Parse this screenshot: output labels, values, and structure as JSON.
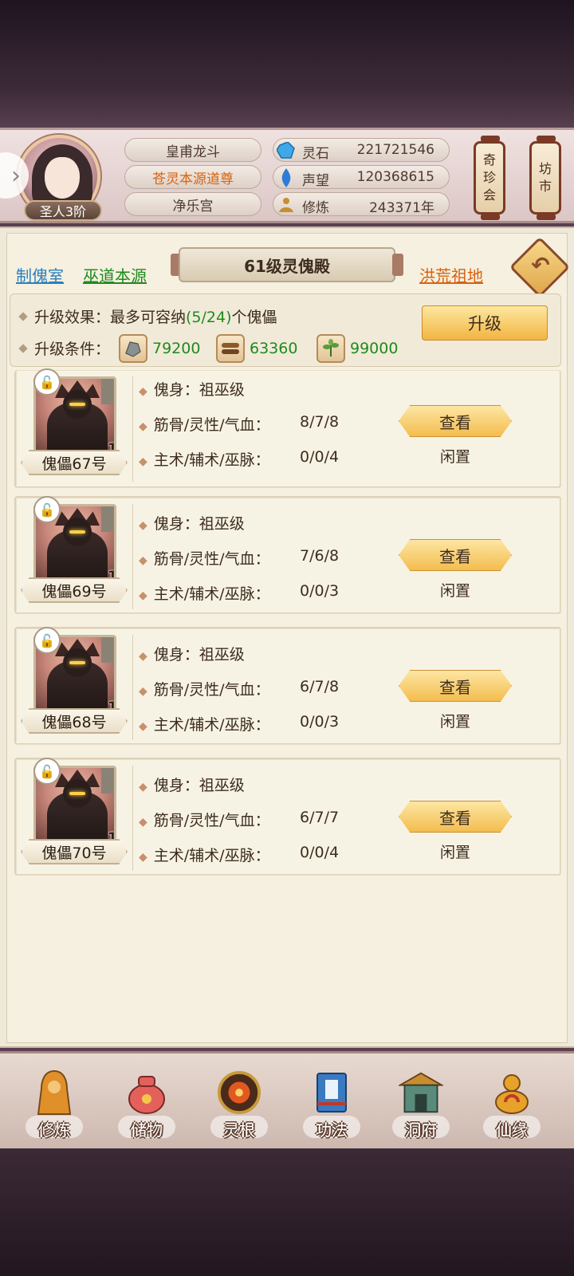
{
  "profile": {
    "rank": "圣人3阶",
    "name": "皇甫龙斗",
    "title": "苍灵本源道尊",
    "sect": "净乐宫"
  },
  "resources": [
    {
      "icon": "spirit-stone-icon",
      "label": "灵石",
      "value": "221721546"
    },
    {
      "icon": "reputation-icon",
      "label": "声望",
      "value": "120368615"
    },
    {
      "icon": "cultivation-icon",
      "label": "修炼",
      "value": "243371年"
    }
  ],
  "lanterns": [
    {
      "label_top": "奇",
      "label_mid": "珍",
      "label_bot": "会"
    },
    {
      "label_top": "坊",
      "label_mid": "市",
      "label_bot": ""
    }
  ],
  "tabs": {
    "left1": "制傀室",
    "left2": "巫道本源",
    "right": "洪荒祖地"
  },
  "hall": {
    "title": "61级灵傀殿",
    "effect_prefix": "升级效果：最多可容纳",
    "effect_count": "(5/24)",
    "effect_suffix": "个傀儡",
    "condition_label": "升级条件：",
    "materials": [
      {
        "icon": "ore-icon",
        "value": "79200"
      },
      {
        "icon": "wood-icon",
        "value": "63360"
      },
      {
        "icon": "herb-icon",
        "value": "99000"
      }
    ],
    "upgrade_label": "升级"
  },
  "puppet_labels": {
    "body": "傀身：祖巫级",
    "attrs": "筋骨/灵性/气血：",
    "skills": "主术/辅术/巫脉：",
    "view": "查看"
  },
  "puppets": [
    {
      "name": "傀儡67号",
      "level": "1级",
      "attrs": "8/7/8",
      "skills": "0/0/4",
      "status": "闲置"
    },
    {
      "name": "傀儡69号",
      "level": "1级",
      "attrs": "7/6/8",
      "skills": "0/0/3",
      "status": "闲置"
    },
    {
      "name": "傀儡68号",
      "level": "1级",
      "attrs": "6/7/8",
      "skills": "0/0/3",
      "status": "闲置"
    },
    {
      "name": "傀儡70号",
      "level": "1级",
      "attrs": "6/7/7",
      "skills": "0/0/4",
      "status": "闲置"
    }
  ],
  "nav": [
    {
      "label": "修炼",
      "icon": "cultivate-icon"
    },
    {
      "label": "储物",
      "icon": "storage-bag-icon"
    },
    {
      "label": "灵根",
      "icon": "spirit-root-icon"
    },
    {
      "label": "功法",
      "icon": "technique-book-icon"
    },
    {
      "label": "洞府",
      "icon": "cave-mansion-icon"
    },
    {
      "label": "仙缘",
      "icon": "immortal-fate-icon"
    }
  ],
  "colors": {
    "accent_gold": "#f3bd4f",
    "green_value": "#1f8a1f",
    "orange_title": "#d9620f",
    "link_blue": "#2a7fc0"
  }
}
